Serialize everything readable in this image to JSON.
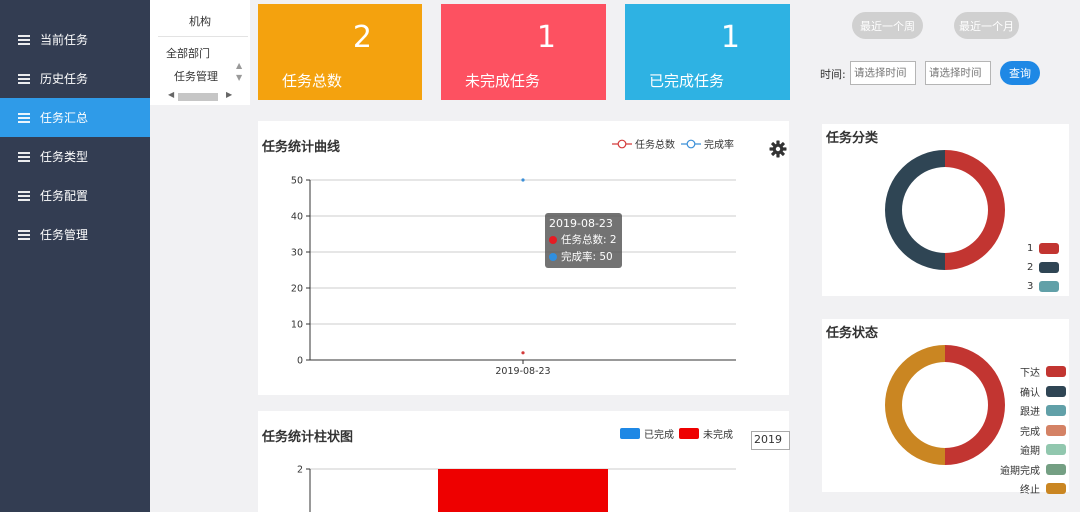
{
  "sidebar": {
    "items": [
      {
        "label": "当前任务"
      },
      {
        "label": "历史任务"
      },
      {
        "label": "任务汇总"
      },
      {
        "label": "任务类型"
      },
      {
        "label": "任务配置"
      },
      {
        "label": "任务管理"
      }
    ],
    "active_index": 2
  },
  "org": {
    "title": "机构",
    "root": "全部部门",
    "child": "任务管理"
  },
  "stats": [
    {
      "value": "2",
      "label": "任务总数",
      "color": "#f4a20e"
    },
    {
      "value": "1",
      "label": "未完成任务",
      "color": "#fd5161"
    },
    {
      "value": "1",
      "label": "已完成任务",
      "color": "#2eb2e3"
    }
  ],
  "date_filter": {
    "week_label": "最近一个周",
    "month_label": "最近一个月",
    "time_label": "时间:",
    "start_placeholder": "请选择时间",
    "end_placeholder": "请选择时间",
    "query_label": "查询"
  },
  "line_panel": {
    "title": "任务统计曲线",
    "legend": [
      "任务总数",
      "完成率"
    ],
    "tooltip": {
      "date": "2019-08-23",
      "total_label": "任务总数: 2",
      "rate_label": "完成率: 50"
    }
  },
  "bar_panel": {
    "title": "任务统计柱状图",
    "legend": [
      "已完成",
      "未完成"
    ],
    "year": "2019"
  },
  "category_panel": {
    "title": "任务分类",
    "legend": [
      "1",
      "2",
      "3"
    ]
  },
  "status_panel": {
    "title": "任务状态",
    "legend": [
      "下达",
      "确认",
      "跟进",
      "完成",
      "逾期",
      "逾期完成",
      "终止"
    ]
  },
  "chart_data": [
    {
      "type": "line",
      "title": "任务统计曲线",
      "x": [
        "2019-08-23"
      ],
      "series": [
        {
          "name": "任务总数",
          "values": [
            2
          ],
          "color": "#d33a3a"
        },
        {
          "name": "完成率",
          "values": [
            50
          ],
          "color": "#3a8fd8"
        }
      ],
      "ylim": [
        0,
        50
      ],
      "yticks": [
        "0",
        "10",
        "20",
        "30",
        "40",
        "50"
      ],
      "grid": true,
      "legend_position": "top-right"
    },
    {
      "type": "bar",
      "title": "任务统计柱状图",
      "yticks_visible": [
        "2"
      ],
      "series": [
        {
          "name": "已完成",
          "color": "#1e88e5"
        },
        {
          "name": "未完成",
          "values": [
            2
          ],
          "color": "#ee0000"
        }
      ],
      "legend_position": "top-right"
    },
    {
      "type": "pie",
      "title": "任务分类",
      "labels": [
        "1",
        "2",
        "3"
      ],
      "values": [
        1,
        1,
        0
      ],
      "colors": [
        "#c23531",
        "#2f4554",
        "#61a0a8"
      ],
      "legend_position": "bottom-right"
    },
    {
      "type": "pie",
      "title": "任务状态",
      "labels": [
        "下达",
        "确认",
        "跟进",
        "完成",
        "逾期",
        "逾期完成",
        "终止"
      ],
      "values": [
        1,
        0,
        0,
        0,
        0,
        0,
        1
      ],
      "colors": [
        "#c23531",
        "#2f4554",
        "#61a0a8",
        "#d48265",
        "#91c7ae",
        "#749f83",
        "#ca8622"
      ],
      "legend_position": "right"
    }
  ]
}
